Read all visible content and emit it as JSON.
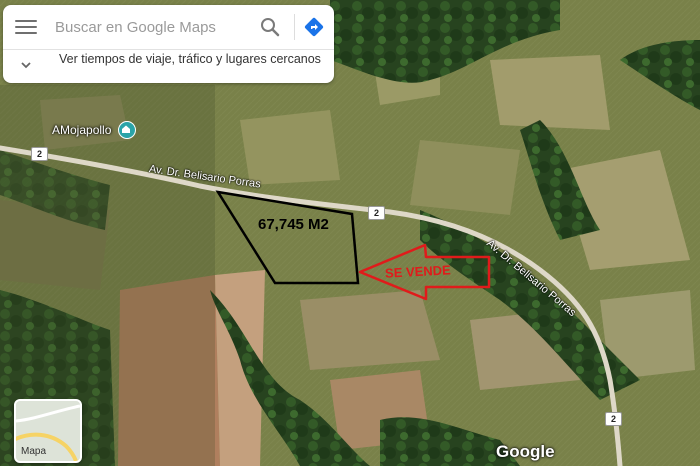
{
  "search": {
    "placeholder": "Buscar en Google Maps",
    "value": ""
  },
  "explore": {
    "text": "Ver tiempos de viaje, tráfico y lugares cercanos"
  },
  "place": {
    "name": "AMojapollo"
  },
  "roads": {
    "name_west": "Av. Dr. Belisario Porras",
    "name_east": "Av. Dr. Belisario Porras",
    "route_number": "2"
  },
  "annotation": {
    "area": "67,745 M2",
    "sale": "SE VENDE"
  },
  "layers": {
    "label": "Mapa"
  },
  "attribution": {
    "logo": "Google"
  },
  "colors": {
    "annotation_red": "#e01b1b",
    "plot_outline": "#000000",
    "road": "#ded8c8",
    "pin": "#2aa4a8"
  },
  "icons": {
    "menu": "menu-icon",
    "search": "search-icon",
    "directions": "directions-icon",
    "expand": "chevron-down-icon",
    "place": "place-icon"
  }
}
